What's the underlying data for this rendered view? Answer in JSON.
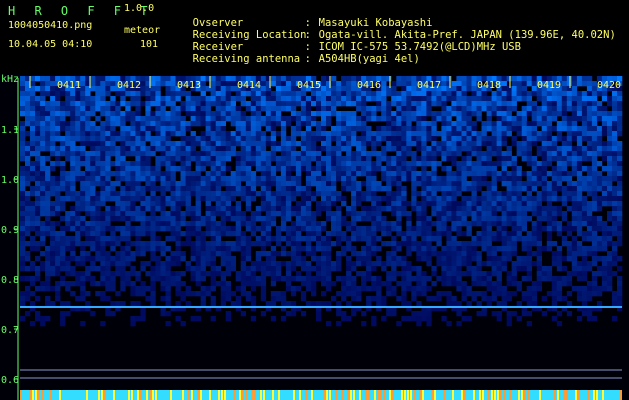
{
  "header": {
    "app_name": "H R O F F T",
    "version": "1.0.0",
    "filename": "1004050410.png",
    "meteor_label": "meteor",
    "date_time": "10.04.05 04:10",
    "meteor_count": "101"
  },
  "meta": [
    {
      "label": "Ovserver",
      "sep": ":",
      "value": "Masayuki Kobayashi"
    },
    {
      "label": "Receiving Location",
      "sep": ":",
      "value": "Ogata-vill. Akita-Pref. JAPAN (139.96E, 40.02N)"
    },
    {
      "label": "Receiver",
      "sep": ":",
      "value": "ICOM IC-575 53.7492(@LCD)MHz USB"
    },
    {
      "label": "Receiving antenna",
      "sep": ":",
      "value": "A504HB(yagi 4el)"
    }
  ],
  "spectrogram": {
    "unit_label": "kHz",
    "y_ticks": [
      "1.1",
      "1.0",
      "0.9",
      "0.8",
      "0.7",
      "0.6"
    ],
    "time_labels": [
      "0411",
      "0412",
      "0413",
      "0414",
      "0415",
      "0416",
      "0417",
      "0418",
      "0419",
      "0420"
    ],
    "colors": {
      "axis": "#66ff66",
      "label": "#ffff66",
      "carrier": "#33aaff"
    }
  }
}
